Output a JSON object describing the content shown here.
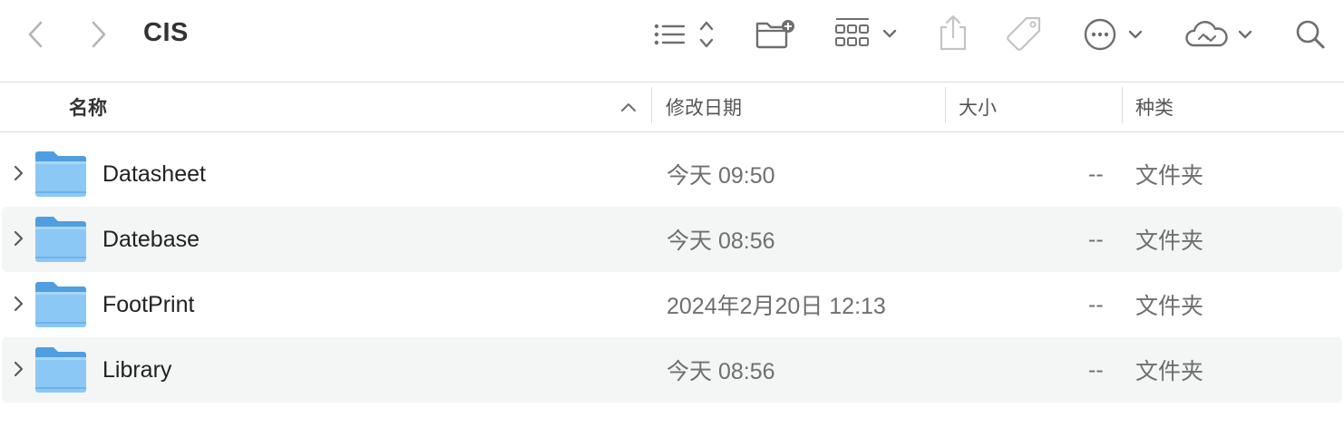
{
  "window": {
    "title": "CIS"
  },
  "toolbar": {
    "back_icon": "chevron-left-icon",
    "forward_icon": "chevron-right-icon",
    "view_icon": "list-view-icon",
    "new_folder_icon": "new-folder-icon",
    "group_icon": "grid-group-icon",
    "share_icon": "share-icon",
    "tag_icon": "tag-icon",
    "more_icon": "ellipsis-circle-icon",
    "cloud_icon": "cloud-sync-icon",
    "search_icon": "search-icon"
  },
  "columns": {
    "name": "名称",
    "modified": "修改日期",
    "size": "大小",
    "kind": "种类"
  },
  "files": [
    {
      "name": "Datasheet",
      "modified": "今天 09:50",
      "size": "--",
      "kind": "文件夹"
    },
    {
      "name": "Datebase",
      "modified": "今天 08:56",
      "size": "--",
      "kind": "文件夹"
    },
    {
      "name": "FootPrint",
      "modified": "2024年2月20日 12:13",
      "size": "--",
      "kind": "文件夹"
    },
    {
      "name": "Library",
      "modified": "今天 08:56",
      "size": "--",
      "kind": "文件夹"
    }
  ],
  "colors": {
    "folder": "#6cb8f0",
    "row_alt": "#f4f5f5"
  }
}
